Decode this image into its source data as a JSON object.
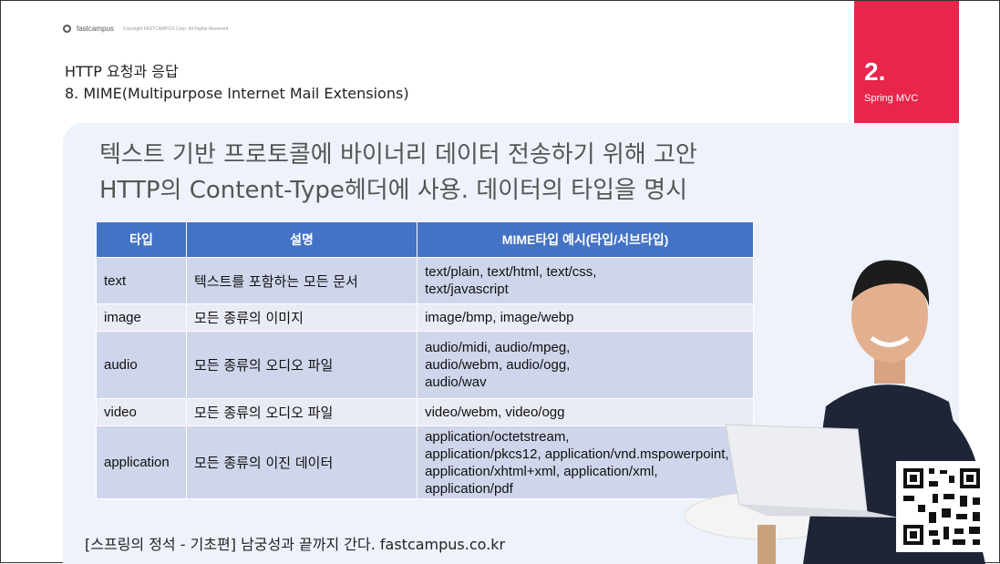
{
  "header": {
    "logo": "fastcampus",
    "copyright": "Copyright FASTCAMPUS Corp. All Rights Reserved",
    "title": "HTTP 요청과 응답",
    "subtitle": "8. MIME(Multipurpose Internet Mail Extensions)"
  },
  "tab": {
    "number": "2",
    "dot": ".",
    "label": "Spring MVC",
    "color": "#e8254a"
  },
  "lead": {
    "line1": "텍스트 기반 프로토콜에 바이너리 데이터 전송하기 위해 고안",
    "line2": "HTTP의 Content-Type헤더에 사용. 데이터의 타입을 명시"
  },
  "table": {
    "headers": [
      "타입",
      "설명",
      "MIME타입 예시(타입/서브타입)"
    ],
    "rows": [
      {
        "type": "text",
        "desc": "텍스트를 포함하는 모든 문서",
        "mime": [
          "text/plain, text/html, text/css,",
          "text/javascript"
        ]
      },
      {
        "type": "image",
        "desc": "모든 종류의 이미지",
        "mime": [
          "image/bmp, image/webp"
        ]
      },
      {
        "type": "audio",
        "desc": "모든 종류의 오디오 파일",
        "mime": [
          "audio/midi, audio/mpeg,",
          "audio/webm, audio/ogg,",
          "audio/wav"
        ]
      },
      {
        "type": "video",
        "desc": "모든 종류의 오디오 파일",
        "mime": [
          "video/webm, video/ogg"
        ]
      },
      {
        "type": "application",
        "desc": "모든 종류의 이진 데이터",
        "mime": [
          "application/octetstream,",
          "application/pkcs12, application/vnd.mspowerpoint,",
          "application/xhtml+xml, application/xml,",
          "application/pdf"
        ]
      }
    ],
    "header_color": "#4472c4"
  },
  "footer": {
    "text": "[스프링의 정석 - 기초편] 남궁성과 끝까지 간다.  fastcampus.co.kr"
  }
}
